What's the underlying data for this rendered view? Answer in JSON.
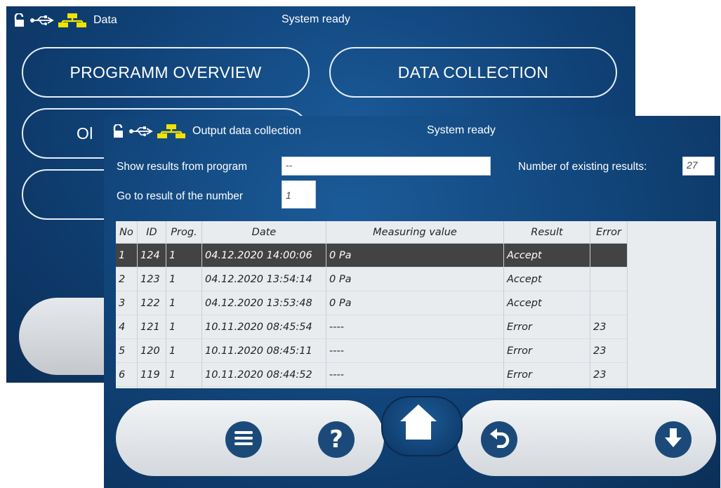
{
  "colors": {
    "window_bg": "#0f3f73",
    "selected_row": "#434343",
    "net_icon": "#f2e200",
    "button_dark": "#1b4a7a"
  },
  "back_window": {
    "status": {
      "mode_label": "Data",
      "status_text": "System ready"
    },
    "buttons": {
      "programm_overview": "PROGRAMM OVERVIEW",
      "data_collection": "DATA COLLECTION",
      "partial_label": "Ol"
    }
  },
  "front_window": {
    "status": {
      "mode_label": "Output data collection",
      "status_text": "System ready"
    },
    "show_results_label": "Show results from program",
    "program_value": "--",
    "existing_results_label": "Number of existing results:",
    "existing_results_count": "27",
    "goto_label": "Go to result of the number",
    "goto_value": "1",
    "table": {
      "headers": {
        "no": "No",
        "id": "ID",
        "prog": "Prog.",
        "date": "Date",
        "mv": "Measuring value",
        "result": "Result",
        "error": "Error"
      },
      "rows": [
        {
          "no": "1",
          "id": "124",
          "prog": "1",
          "date": "04.12.2020 14:00:06",
          "mv": "0 Pa",
          "result": "Accept",
          "error": ""
        },
        {
          "no": "2",
          "id": "123",
          "prog": "1",
          "date": "04.12.2020 13:54:14",
          "mv": "0 Pa",
          "result": "Accept",
          "error": ""
        },
        {
          "no": "3",
          "id": "122",
          "prog": "1",
          "date": "04.12.2020 13:53:48",
          "mv": "0 Pa",
          "result": "Accept",
          "error": ""
        },
        {
          "no": "4",
          "id": "121",
          "prog": "1",
          "date": "10.11.2020 08:45:54",
          "mv": "----",
          "result": "Error",
          "error": "23"
        },
        {
          "no": "5",
          "id": "120",
          "prog": "1",
          "date": "10.11.2020 08:45:11",
          "mv": "----",
          "result": "Error",
          "error": "23"
        },
        {
          "no": "6",
          "id": "119",
          "prog": "1",
          "date": "10.11.2020 08:44:52",
          "mv": "----",
          "result": "Error",
          "error": "23"
        },
        {
          "no": "",
          "id": "",
          "prog": "",
          "date": "",
          "mv": "",
          "result": "",
          "error": ""
        }
      ]
    },
    "footer": {
      "help_glyph": "?"
    },
    "icons": [
      "unlock-icon",
      "usb-icon",
      "network-icon",
      "menu-icon",
      "help-icon",
      "home-icon",
      "back-icon",
      "download-icon"
    ]
  }
}
